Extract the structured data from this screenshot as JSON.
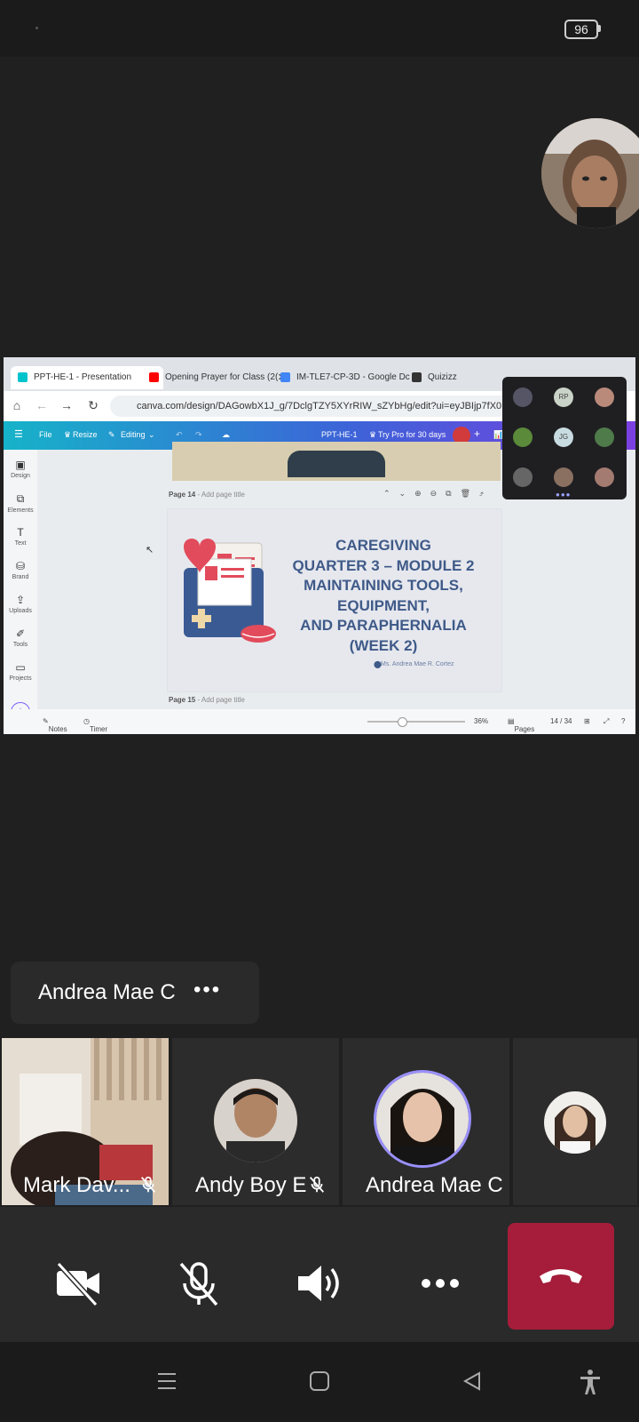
{
  "status_bar": {
    "battery": "96"
  },
  "shared_screen": {
    "tabs": [
      {
        "label": "PPT-HE-1 - Presentation",
        "active": true,
        "icon_color": "#00c4cc"
      },
      {
        "label": "Opening Prayer for Class (2(",
        "active": false,
        "icon_color": "#ff0000"
      },
      {
        "label": "IM-TLE7-CP-3D - Google Dc",
        "active": false,
        "icon_color": "#4285f4"
      },
      {
        "label": "Quizizz",
        "active": false,
        "icon_color": "#333333"
      }
    ],
    "address": "canva.com/design/DAGowbX1J_g/7DclgTZY5XYrRIW_sZYbHg/edit?ui=eyJBIjp7fX0",
    "canva_toolbar": {
      "file": "File",
      "resize": "Resize",
      "editing": "Editing",
      "doc_title": "PPT-HE-1",
      "pro": "Try Pro for 30 days"
    },
    "left_rail": [
      "Design",
      "Elements",
      "Text",
      "Brand",
      "Uploads",
      "Tools",
      "Projects"
    ],
    "page14_label": "Page 14",
    "page14_add": "- Add page title",
    "page15_label": "Page 15",
    "page15_add": "- Add page title",
    "slide": {
      "title_lines": [
        "CAREGIVING",
        "QUARTER 3 – MODULE 2",
        "MAINTAINING TOOLS,",
        "EQUIPMENT,",
        "AND PARAPHERNALIA",
        "(WEEK 2)"
      ],
      "author": "Ms. Andrea Mae R. Cortez"
    },
    "bottom_bar": {
      "notes": "Notes",
      "timer": "Timer",
      "zoom": "36%",
      "pages": "Pages",
      "page_count": "14 / 34"
    },
    "people_panel": {
      "initials": [
        "RP",
        "JG"
      ]
    }
  },
  "speaker_chip": {
    "name": "Andrea Mae C",
    "more": "•••"
  },
  "participants": [
    {
      "name": "Mark Dav...",
      "muted": true
    },
    {
      "name": "Andy Boy E",
      "muted": true
    },
    {
      "name": "Andrea Mae C",
      "muted": false,
      "speaking": true
    },
    {
      "name": "",
      "muted": false
    }
  ],
  "controls": {
    "camera": "camera-off",
    "mic": "mic-off",
    "speaker": "speaker-on",
    "more": "more",
    "end_call_color": "#a51d3a"
  }
}
